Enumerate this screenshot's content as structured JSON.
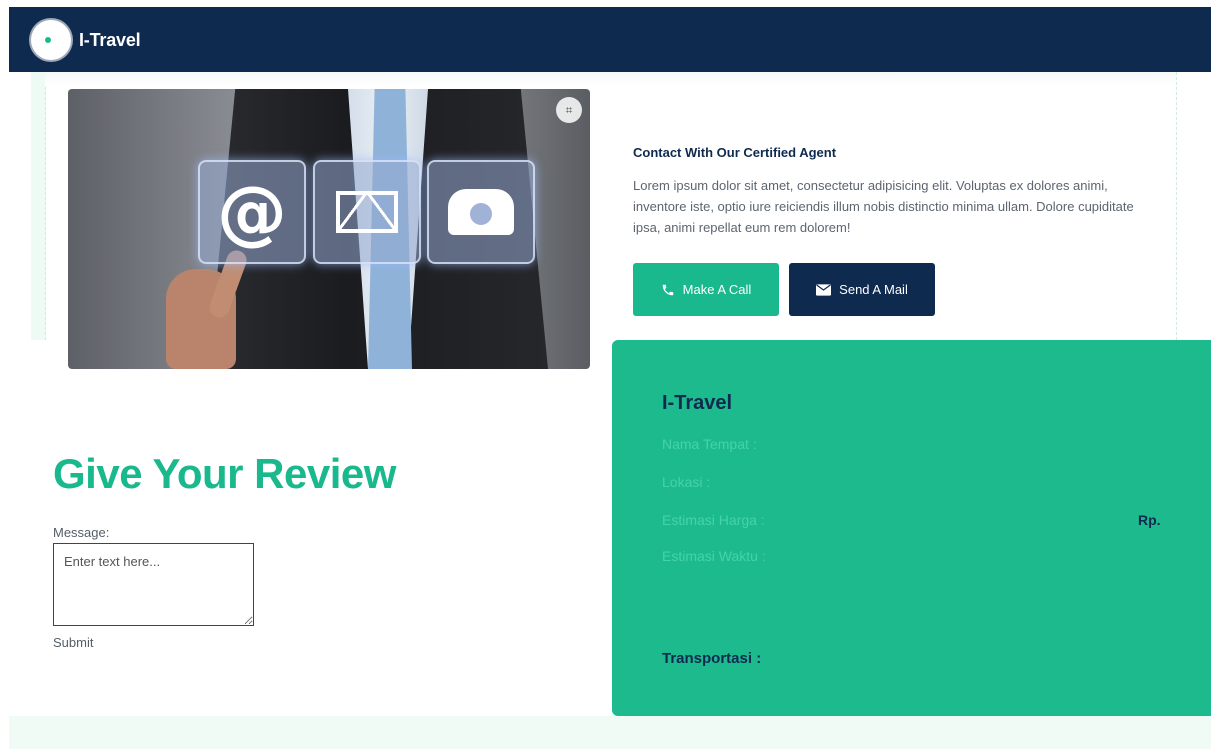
{
  "navbar": {
    "brand": "I-Travel"
  },
  "contact": {
    "title": "Contact With Our Certified Agent",
    "description": "Lorem ipsum dolor sit amet, consectetur adipisicing elit. Voluptas ex dolores animi, inventore iste, optio iure reiciendis illum nobis distinctio minima ullam. Dolore cupiditate ipsa, animi repellat eum rem dolorem!",
    "call_label": "Make A Call",
    "mail_label": "Send A Mail"
  },
  "hero_image": {
    "tiles": [
      "@",
      "mail",
      "phone"
    ]
  },
  "review": {
    "title": "Give Your Review",
    "message_label": "Message:",
    "message_placeholder": "Enter text here...",
    "submit_label": "Submit"
  },
  "card": {
    "title": "I-Travel",
    "fields": [
      "Nama Tempat :",
      "Lokasi :",
      "Estimasi Harga :",
      "Estimasi Waktu :"
    ],
    "currency": "Rp.",
    "transport_label": "Transportasi :"
  },
  "colors": {
    "navy": "#0f2a4f",
    "green": "#19b88d",
    "card_green": "#1dba8e"
  }
}
